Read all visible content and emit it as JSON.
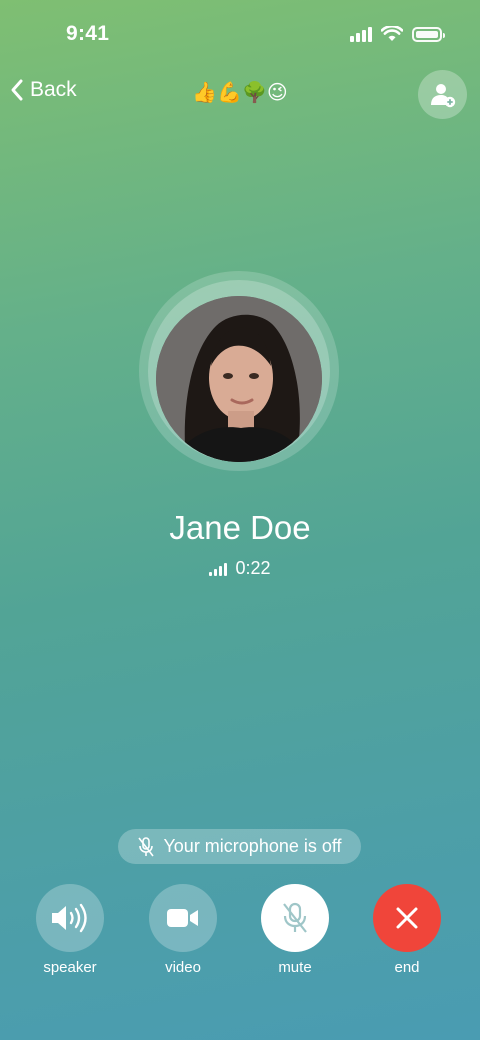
{
  "status_bar": {
    "time": "9:41"
  },
  "nav": {
    "back_label": "Back",
    "emojis": "👍💪🌳😉"
  },
  "caller": {
    "name": "Jane Doe",
    "duration": "0:22"
  },
  "notice": {
    "mic_off": "Your microphone is off"
  },
  "controls": [
    {
      "label": "speaker",
      "icon": "speaker-icon"
    },
    {
      "label": "video",
      "icon": "video-camera-icon"
    },
    {
      "label": "mute",
      "icon": "mic-off-icon"
    },
    {
      "label": "end",
      "icon": "close-icon"
    }
  ],
  "colors": {
    "end_call": "#f0453a",
    "mute_icon": "#9fc6c8"
  }
}
